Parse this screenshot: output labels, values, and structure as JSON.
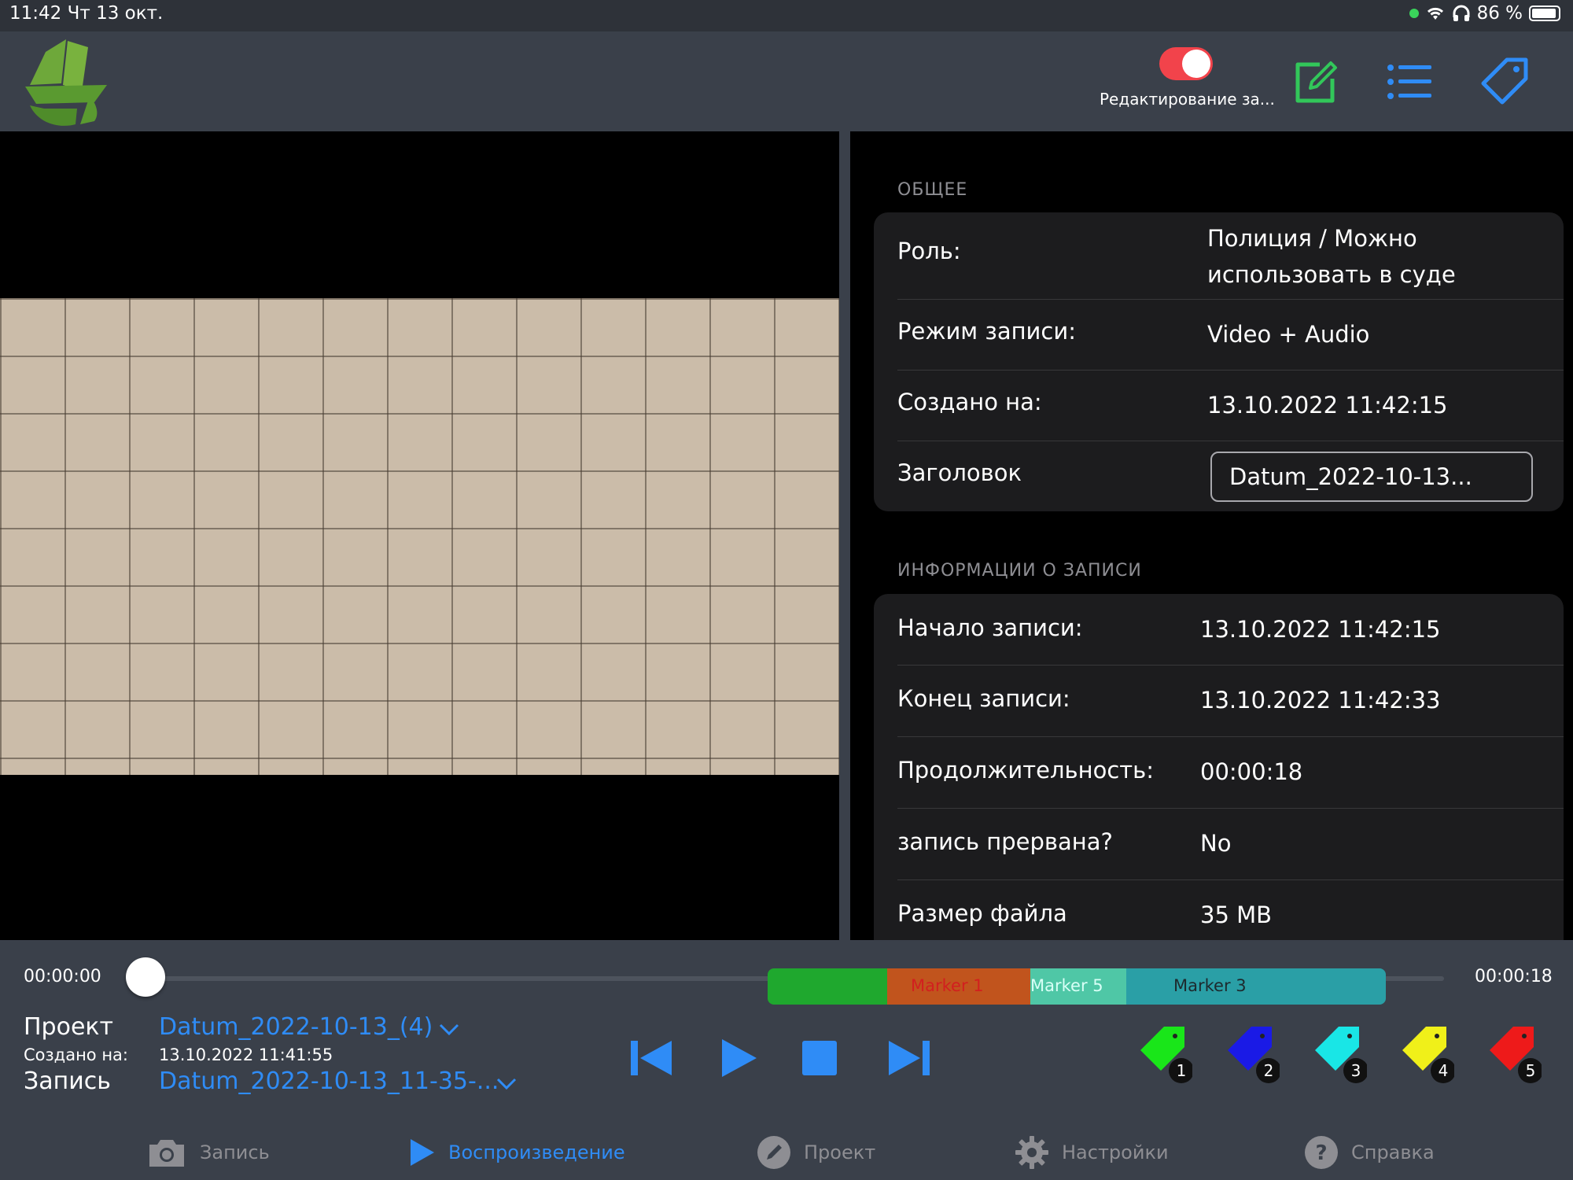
{
  "status_bar": {
    "time_date": "11:42   Чт 13 окт.",
    "battery": "86 %"
  },
  "header": {
    "toggle_label": "Редактирование за...",
    "toggle_on": true,
    "icons": [
      "edit-icon",
      "list-icon",
      "tag-icon"
    ],
    "colors": {
      "toggle": "#f2434b",
      "edit": "#32c75a",
      "accent": "#2f8cf6"
    }
  },
  "general": {
    "section_title": "ОБЩЕЕ",
    "role_label": "Роль:",
    "role_value_line1": "Полиция / Можно",
    "role_value_line2": "использовать в суде",
    "mode_label": "Режим записи:",
    "mode_value": "Video + Audio",
    "created_label": "Создано на:",
    "created_value": "13.10.2022 11:42:15",
    "title_label": "Заголовок",
    "title_value": "Datum_2022-10-13..."
  },
  "record_info": {
    "section_title": "ИНФОРМАЦИИ О ЗАПИСИ",
    "rows": [
      {
        "label": "Начало записи:",
        "value": "13.10.2022 11:42:15"
      },
      {
        "label": "Конец записи:",
        "value": "13.10.2022 11:42:33"
      },
      {
        "label": "Продолжительность:",
        "value": "00:00:18"
      },
      {
        "label": "запись прервана?",
        "value": "No"
      },
      {
        "label": "Размер файла",
        "value": "35 MB"
      }
    ]
  },
  "timeline": {
    "start_time": "00:00:00",
    "end_time": "00:00:18",
    "position": 0.0,
    "markers": [
      {
        "label": "",
        "color": "#1fa82e"
      },
      {
        "label": "Marker 1",
        "color": "#c1541d",
        "text_color": "#d21f1f"
      },
      {
        "label": "Marker 5",
        "color": "#4fc7a6",
        "text_color": "#d8fff6"
      },
      {
        "label": "Marker 3",
        "color": "#2a9fa6",
        "text_color": "#1d2a2e"
      }
    ]
  },
  "project": {
    "project_label": "Проект",
    "project_value": "Datum_2022-10-13_(4)",
    "created_label": "Создано на:",
    "created_value": "13.10.2022 11:41:55",
    "record_label": "Запись",
    "record_value": "Datum_2022-10-13_11-35-..."
  },
  "playback_controls": [
    "skip-back-icon",
    "play-icon",
    "stop-icon",
    "skip-forward-icon"
  ],
  "tag_buttons": [
    {
      "number": "1",
      "color": "#19e619"
    },
    {
      "number": "2",
      "color": "#1a1ae6"
    },
    {
      "number": "3",
      "color": "#19e6e6"
    },
    {
      "number": "4",
      "color": "#f0f019"
    },
    {
      "number": "5",
      "color": "#ee1a1a"
    }
  ],
  "tabs": [
    {
      "label": "Запись",
      "icon": "camera-icon",
      "active": false
    },
    {
      "label": "Воспроизведение",
      "icon": "play-icon",
      "active": true
    },
    {
      "label": "Проект",
      "icon": "pencil-icon",
      "active": false
    },
    {
      "label": "Настройки",
      "icon": "gear-icon",
      "active": false
    },
    {
      "label": "Справка",
      "icon": "help-icon",
      "active": false
    }
  ]
}
